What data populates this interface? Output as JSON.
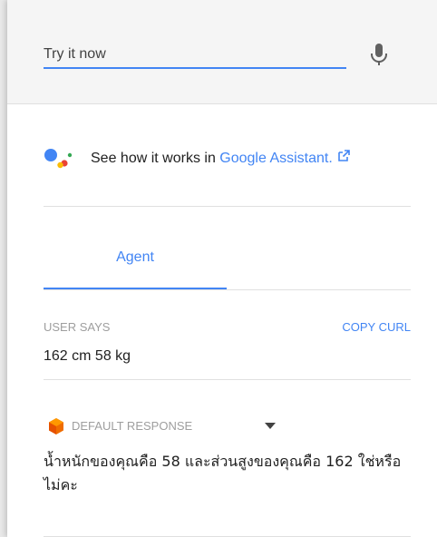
{
  "try_it": {
    "placeholder": "Try it now",
    "mic_icon": "microphone-icon"
  },
  "assistant": {
    "prefix": "See how it works in ",
    "link": "Google Assistant.",
    "logo_icon": "google-assistant-logo",
    "external_icon": "external-link-icon",
    "colors": {
      "blue": "#4285f4",
      "red": "#ea4335",
      "yellow": "#fbbc05",
      "green": "#34a853"
    }
  },
  "tabs": [
    {
      "label": "Agent",
      "active": true
    }
  ],
  "user_says": {
    "label": "USER SAYS",
    "value": "162 cm 58 kg",
    "copy_label": "COPY CURL"
  },
  "response": {
    "label": "DEFAULT RESPONSE",
    "text": "น้ำหนักของคุณคือ 58 และส่วนสูงของคุณคือ 162 ใช่หรือไม่คะ",
    "icon": "dialogflow-icon",
    "caret_icon": "caret-down-icon"
  },
  "accent": "#4285f4"
}
